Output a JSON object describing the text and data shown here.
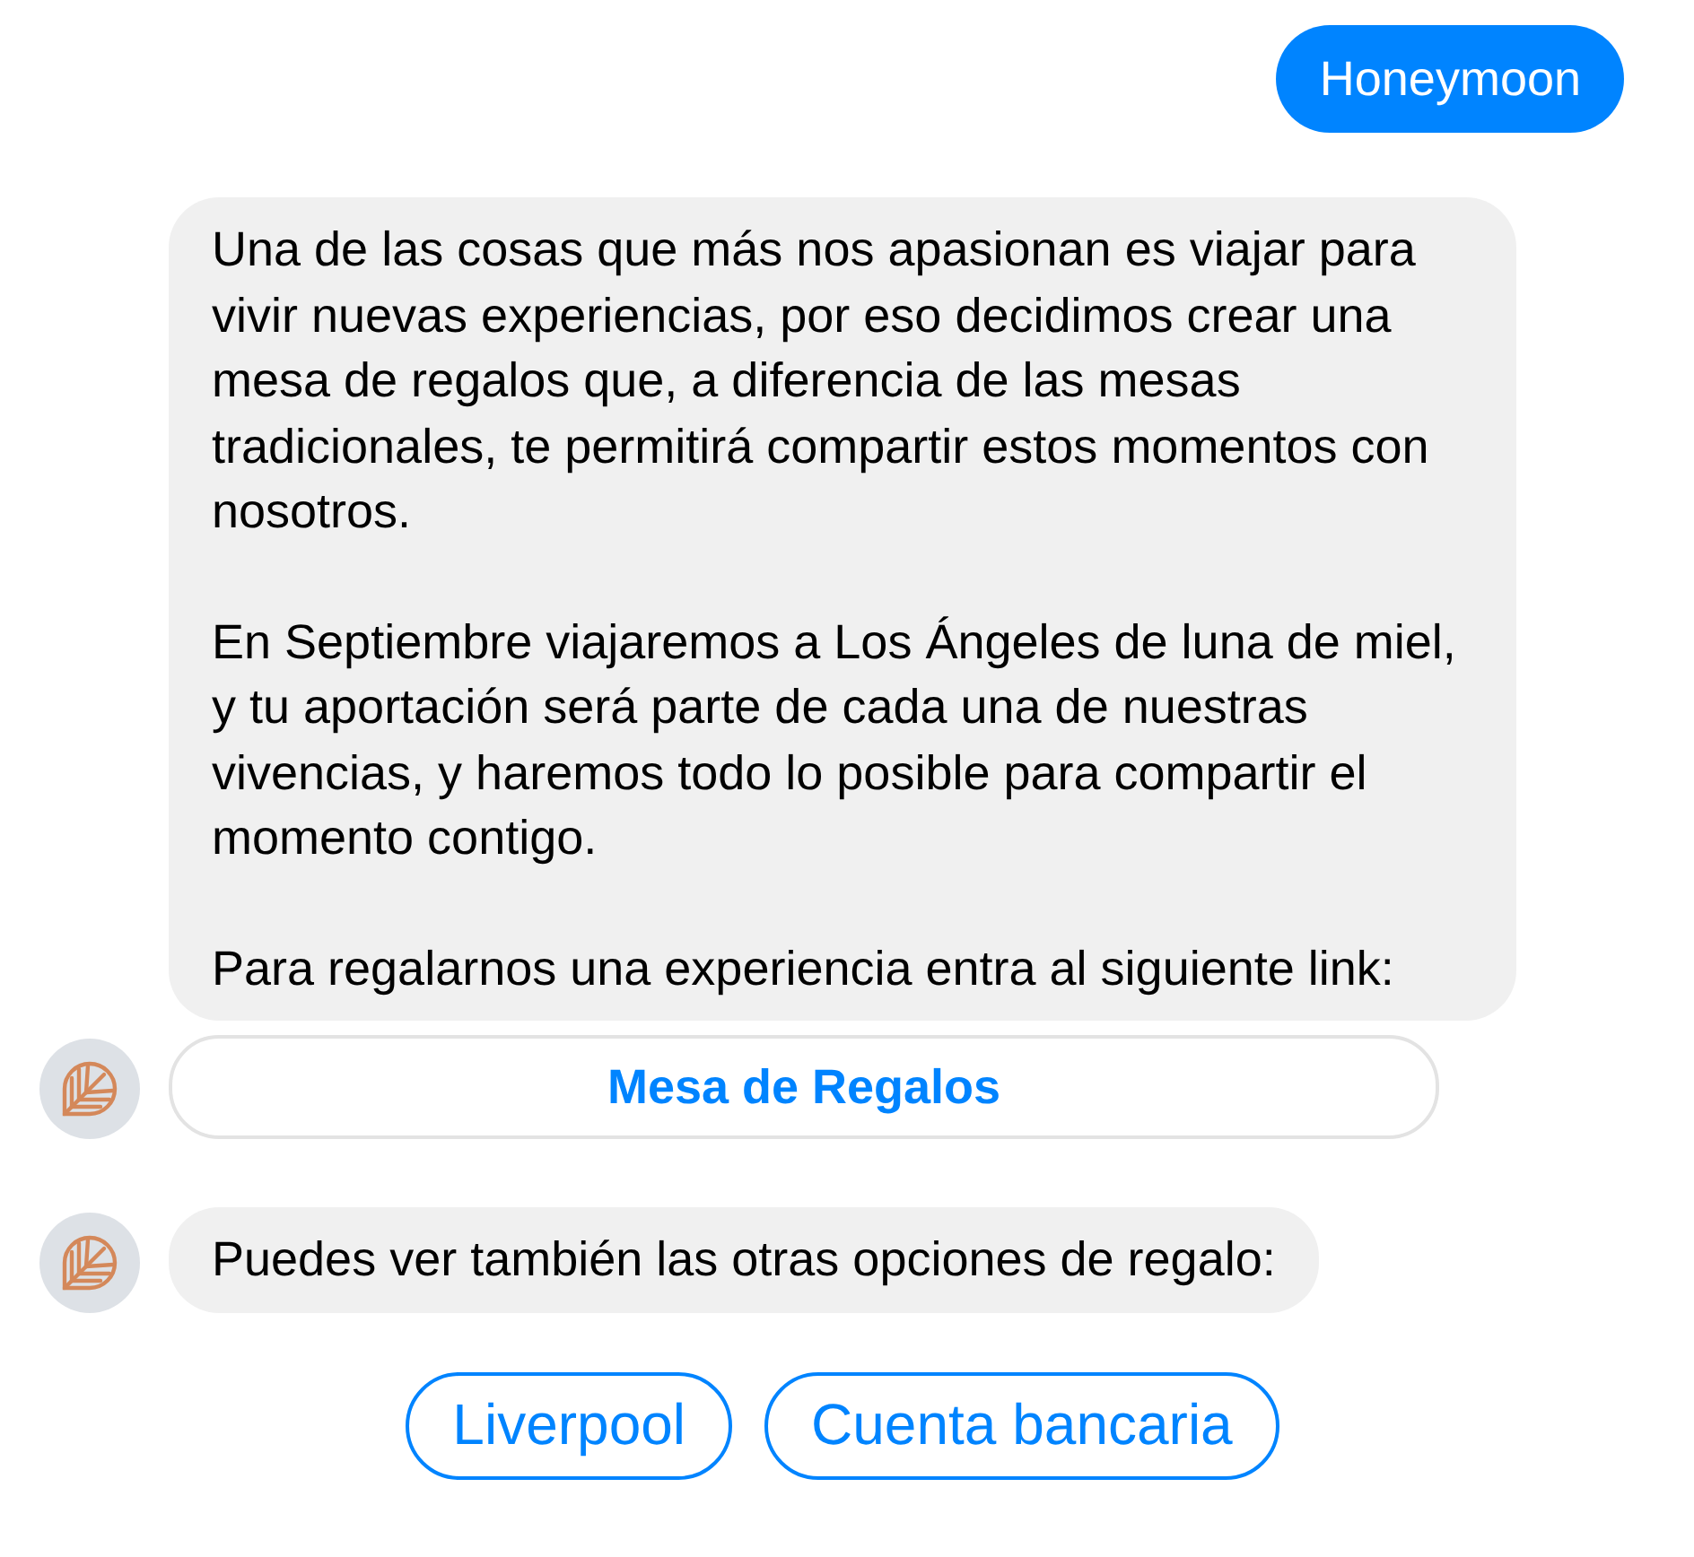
{
  "messages": [
    {
      "kind": "user",
      "text": "Honeymoon"
    },
    {
      "kind": "bot",
      "avatar": false,
      "paragraphs": [
        "Una de las cosas que más nos apasionan es viajar para vivir nuevas experiencias, por eso decidimos crear una mesa de regalos que, a diferencia de las mesas tradicionales, te permitirá compartir estos momentos con nosotros.",
        "En Septiembre viajaremos a Los Ángeles de luna de miel, y tu aportación será parte de cada una de nuestras vivencias, y haremos todo lo posible para compartir el momento contigo.",
        "Para regalarnos una experiencia entra al siguiente link:"
      ]
    },
    {
      "kind": "link",
      "avatar": true,
      "label": "Mesa de Regalos"
    },
    {
      "kind": "bot",
      "avatar": true,
      "paragraphs": [
        "Puedes ver también las otras opciones de regalo:"
      ]
    }
  ],
  "quick_replies": [
    "Liverpool",
    "Cuenta bancaria"
  ]
}
